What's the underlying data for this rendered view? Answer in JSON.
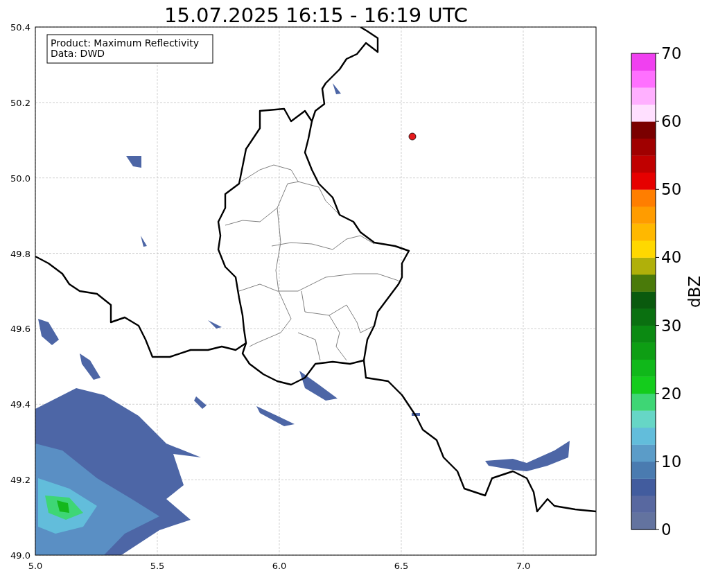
{
  "title": "15.07.2025 16:15 - 16:19 UTC",
  "info_box": [
    "Product: Maximum Reflectivity",
    "Data: DWD"
  ],
  "x_axis": {
    "ticks": [
      "5.0",
      "5.5",
      "6.0",
      "6.5",
      "7.0"
    ]
  },
  "y_axis": {
    "ticks": [
      "50.4",
      "50.2",
      "50.0",
      "49.8",
      "49.6",
      "49.4",
      "49.2",
      "49.0"
    ]
  },
  "colorbar": {
    "label": "dBZ",
    "ticks": [
      "70",
      "60",
      "50",
      "40",
      "30",
      "20",
      "10",
      "0"
    ],
    "steps": [
      {
        "color": "#63739f"
      },
      {
        "color": "#5868a0"
      },
      {
        "color": "#425c9e"
      },
      {
        "color": "#4a7bb0"
      },
      {
        "color": "#5b9cc8"
      },
      {
        "color": "#62bddb"
      },
      {
        "color": "#66d6c6"
      },
      {
        "color": "#3ed675"
      },
      {
        "color": "#14cc1c"
      },
      {
        "color": "#10b81a"
      },
      {
        "color": "#0e9e14"
      },
      {
        "color": "#0b8a12"
      },
      {
        "color": "#0a7010"
      },
      {
        "color": "#0a5a0e"
      },
      {
        "color": "#4a7a0a"
      },
      {
        "color": "#b0b00a"
      },
      {
        "color": "#ffd800"
      },
      {
        "color": "#ffb800"
      },
      {
        "color": "#ff9c00"
      },
      {
        "color": "#ff7e00"
      },
      {
        "color": "#e60000"
      },
      {
        "color": "#c00000"
      },
      {
        "color": "#a00000"
      },
      {
        "color": "#7a0000"
      },
      {
        "color": "#ffe0ff"
      },
      {
        "color": "#ffb0ff"
      },
      {
        "color": "#ff70ff"
      },
      {
        "color": "#f040f0"
      }
    ]
  }
}
